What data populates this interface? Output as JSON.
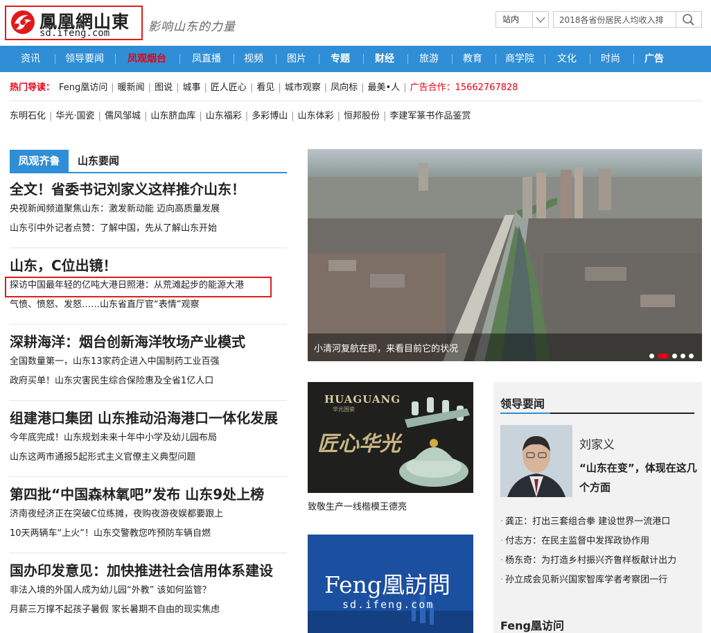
{
  "header": {
    "logo_cn": "鳳凰網山東",
    "logo_url": "sd.ifeng.com",
    "slogan": "影响山东的力量",
    "scope": "站内",
    "search_placeholder": "2018各省份居民人均收入排"
  },
  "nav": {
    "items": [
      {
        "label": "资讯"
      },
      {
        "label": "领导要闻"
      },
      {
        "label": "凤观烟台"
      },
      {
        "label": "凤直播"
      },
      {
        "label": "视频"
      },
      {
        "label": "图片"
      },
      {
        "label": "专题"
      },
      {
        "label": "财经"
      },
      {
        "label": "旅游"
      },
      {
        "label": "教育"
      },
      {
        "label": "商学院"
      },
      {
        "label": "文化"
      },
      {
        "label": "时尚"
      },
      {
        "label": "广告"
      }
    ]
  },
  "hot": {
    "label": "热门导读：",
    "links": [
      "Feng凰访问",
      "暖新闻",
      "图说",
      "城事",
      "匠人匠心",
      "看见",
      "城市观察",
      "凤向标",
      "最美•人"
    ],
    "ad_contact": "广告合作：15662767828"
  },
  "sponsors": [
    "东明石化",
    "华光·国瓷",
    "儒风邹城",
    "山东脐血库",
    "山东福彩",
    "多彩博山",
    "山东体彩",
    "恒邦股份",
    "李建军篆书作品鉴赏"
  ],
  "tabs": {
    "active": "凤观齐鲁",
    "second": "山东要闻"
  },
  "stories": [
    {
      "title": "全文！省委书记刘家义这样推介山东！",
      "subs": [
        "央视新闻频道聚焦山东：激发新动能 迈向高质量发展",
        "山东引中外记者点赞：了解中国，先从了解山东开始"
      ]
    },
    {
      "title": "山东，C位出镜！",
      "subs": [
        "探访中国最年轻的亿吨大港日照港：从荒滩起步的能源大港",
        "气愤、愤怒、发怒……山东省直厅官“表情”观察"
      ]
    },
    {
      "title": "深耕海洋：烟台创新海洋牧场产业模式",
      "subs": [
        "全国数量第一，山东13家药企进入中国制药工业百强",
        "政府买单！山东灾害民生综合保险惠及全省1亿人口"
      ]
    },
    {
      "title": "组建港口集团 山东推动沿海港口一体化发展",
      "subs": [
        "今年底完成！山东规划未来十年中小学及幼儿园布局",
        "山东这两市通报5起形式主义官僚主义典型问题"
      ]
    },
    {
      "title": "第四批“中国森林氧吧”发布 山东9处上榜",
      "subs": [
        "济南夜经济正在突破C位练摊，夜购夜游夜娱都要跟上",
        "10天两辆车“上火”！山东交警教您咋预防车辆自燃"
      ]
    },
    {
      "title": "国办印发意见：加快推进社会信用体系建设",
      "subs": [
        "非法入境的外国人成为幼儿园“外教” 该如何监管？",
        "月薪三万撑不起孩子暑假 家长暑期不自由的现实焦虑"
      ]
    }
  ],
  "hero": {
    "caption": "小清河复航在即，来看目前它的状况"
  },
  "ad1": {
    "brand": "HUAGUANG",
    "brand_sub": "华光国瓷",
    "slogan": "匠心华光",
    "caption": "致敬生产一线楷模王德亮"
  },
  "ad2": {
    "title": "Feng凰訪問",
    "url": "sd.ifeng.com"
  },
  "leader": {
    "heading": "领导要闻",
    "name": "刘家义",
    "quote": "“山东在变”，体现在这几个方面",
    "items": [
      "龚正：打出三套组合拳 建设世界一流港口",
      "付志方：在民主监督中发挥政协作用",
      "杨东奇：为打造乡村振兴齐鲁样板献计出力",
      "孙立成会见新兴国家智库学者考察团一行"
    ],
    "feng_heading": "Feng凰访问"
  },
  "colors": {
    "nav_blue": "#2f8ed5",
    "brand_red": "#e60012",
    "panel_gray": "#f2f2f2"
  }
}
